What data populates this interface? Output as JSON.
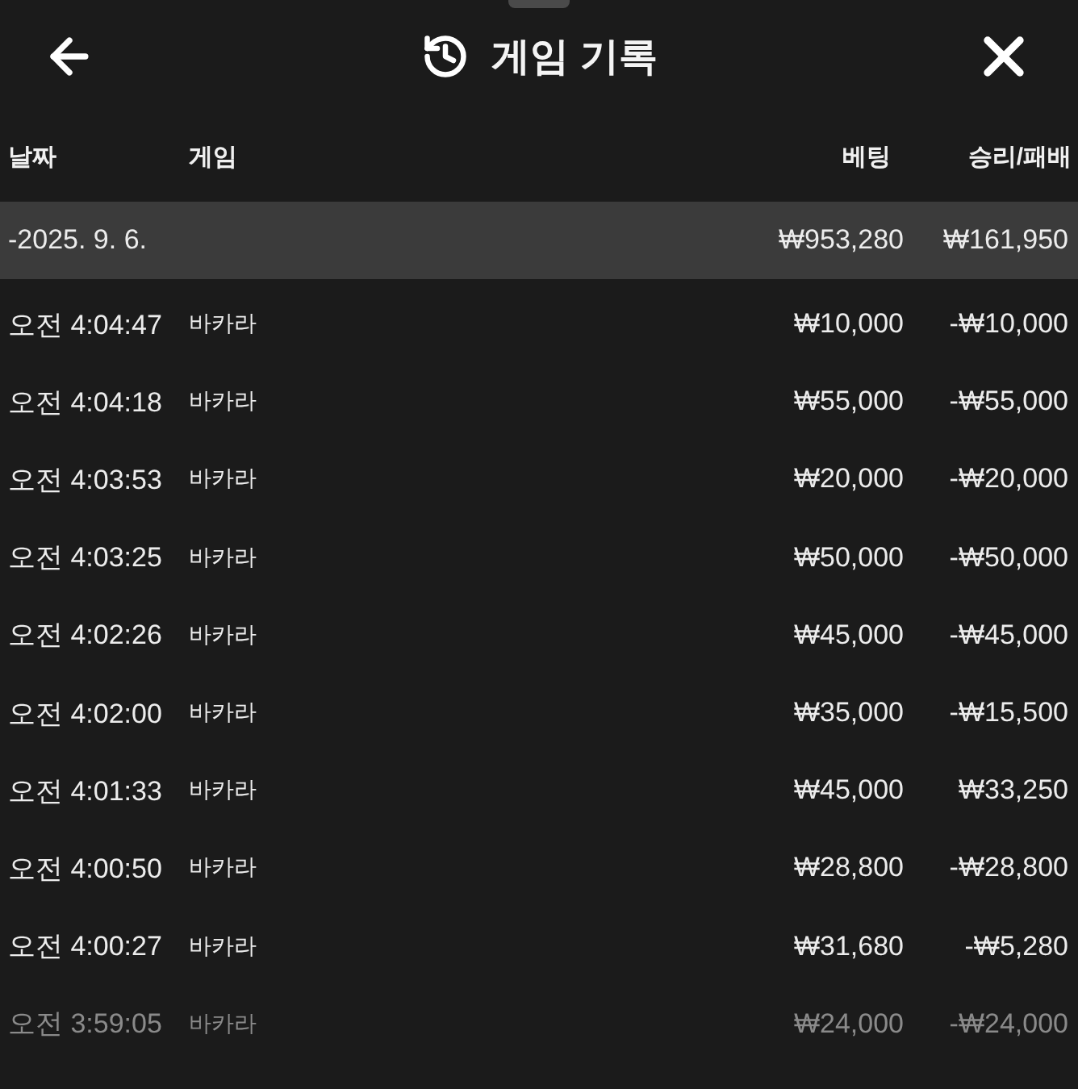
{
  "header": {
    "title": "게임 기록"
  },
  "columns": [
    "날짜",
    "게임",
    "베팅",
    "승리/패배"
  ],
  "summary": {
    "date": "-2025. 9. 6.",
    "bet": "₩953,280",
    "result": "₩161,950"
  },
  "rows": [
    {
      "time": "오전 4:04:47",
      "game": "바카라",
      "bet": "₩10,000",
      "result": "-₩10,000",
      "faded": false
    },
    {
      "time": "오전 4:04:18",
      "game": "바카라",
      "bet": "₩55,000",
      "result": "-₩55,000",
      "faded": false
    },
    {
      "time": "오전 4:03:53",
      "game": "바카라",
      "bet": "₩20,000",
      "result": "-₩20,000",
      "faded": false
    },
    {
      "time": "오전 4:03:25",
      "game": "바카라",
      "bet": "₩50,000",
      "result": "-₩50,000",
      "faded": false
    },
    {
      "time": "오전 4:02:26",
      "game": "바카라",
      "bet": "₩45,000",
      "result": "-₩45,000",
      "faded": false
    },
    {
      "time": "오전 4:02:00",
      "game": "바카라",
      "bet": "₩35,000",
      "result": "-₩15,500",
      "faded": false
    },
    {
      "time": "오전 4:01:33",
      "game": "바카라",
      "bet": "₩45,000",
      "result": "₩33,250",
      "faded": false
    },
    {
      "time": "오전 4:00:50",
      "game": "바카라",
      "bet": "₩28,800",
      "result": "-₩28,800",
      "faded": false
    },
    {
      "time": "오전 4:00:27",
      "game": "바카라",
      "bet": "₩31,680",
      "result": "-₩5,280",
      "faded": false
    },
    {
      "time": "오전 3:59:05",
      "game": "바카라",
      "bet": "₩24,000",
      "result": "-₩24,000",
      "faded": true
    }
  ]
}
